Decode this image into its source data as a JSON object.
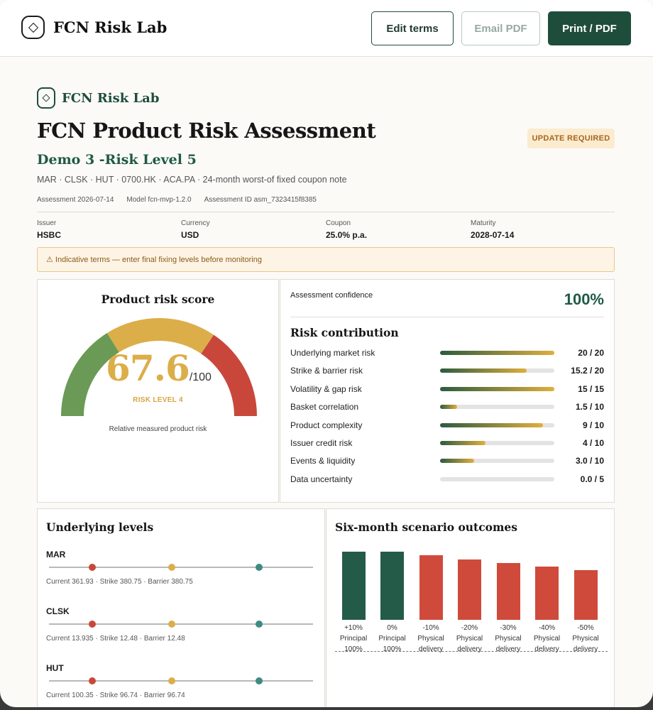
{
  "app": {
    "name": "FCN Risk Lab",
    "buttons": {
      "edit": "Edit terms",
      "email": "Email PDF",
      "print": "Print / PDF"
    }
  },
  "report": {
    "brand": "FCN Risk Lab",
    "title": "FCN Product Risk Assessment",
    "status_badge": "UPDATE REQUIRED",
    "subtitle": "Demo 3 -Risk Level 5",
    "description": "MAR · CLSK · HUT · 0700.HK · ACA.PA · 24-month worst-of fixed coupon note",
    "meta": {
      "assessment": "Assessment 2026-07-14",
      "model": "Model fcn-mvp-1.2.0",
      "assessment_id": "Assessment ID asm_7323415f8385"
    },
    "terms": [
      {
        "label": "Issuer",
        "value": "HSBC"
      },
      {
        "label": "Currency",
        "value": "USD"
      },
      {
        "label": "Coupon",
        "value": "25.0% p.a."
      },
      {
        "label": "Maturity",
        "value": "2028-07-14"
      }
    ],
    "notice": "⚠ Indicative terms — enter final fixing levels before monitoring"
  },
  "score": {
    "title": "Product risk score",
    "value": "67.6",
    "max": "/100",
    "level": "RISK LEVEL 4",
    "caption": "Relative measured product risk",
    "colors": {
      "low": "#6a9a55",
      "mid": "#dcae49",
      "high": "#c9473a"
    }
  },
  "confidence": {
    "label": "Assessment confidence",
    "value": "100%"
  },
  "contribution": {
    "title": "Risk contribution",
    "rows": [
      {
        "label": "Underlying market risk",
        "value": "20 / 20",
        "fraction": 1.0
      },
      {
        "label": "Strike & barrier risk",
        "value": "15.2 / 20",
        "fraction": 0.76
      },
      {
        "label": "Volatility & gap risk",
        "value": "15 / 15",
        "fraction": 1.0
      },
      {
        "label": "Basket correlation",
        "value": "1.5 / 10",
        "fraction": 0.15
      },
      {
        "label": "Product complexity",
        "value": "9 / 10",
        "fraction": 0.9
      },
      {
        "label": "Issuer credit risk",
        "value": "4 / 10",
        "fraction": 0.4
      },
      {
        "label": "Events & liquidity",
        "value": "3.0 / 10",
        "fraction": 0.3
      },
      {
        "label": "Data uncertainty",
        "value": "0.0 / 5",
        "fraction": 0.0
      }
    ]
  },
  "levels": {
    "title": "Underlying levels",
    "items": [
      {
        "ticker": "MAR",
        "info": "Current 361.93 · Strike 380.75 · Barrier 380.75"
      },
      {
        "ticker": "CLSK",
        "info": "Current 13.935 · Strike 12.48 · Barrier 12.48"
      },
      {
        "ticker": "HUT",
        "info": "Current 100.35 · Strike 96.74 · Barrier 96.74"
      }
    ],
    "colors": {
      "red": "#c9473a",
      "yellow": "#dcae49",
      "teal": "#3f8a82"
    }
  },
  "scenarios": {
    "title": "Six-month scenario outcomes",
    "items": [
      {
        "move": "+10%",
        "l1": "Principal",
        "l2": "100%",
        "height": 1.0,
        "color": "#245b48"
      },
      {
        "move": "0%",
        "l1": "Principal",
        "l2": "100%",
        "height": 1.0,
        "color": "#245b48"
      },
      {
        "move": "-10%",
        "l1": "Physical",
        "l2": "delivery",
        "height": 0.95,
        "color": "#cf4a3b"
      },
      {
        "move": "-20%",
        "l1": "Physical",
        "l2": "delivery",
        "height": 0.89,
        "color": "#cf4a3b"
      },
      {
        "move": "-30%",
        "l1": "Physical",
        "l2": "delivery",
        "height": 0.83,
        "color": "#cf4a3b"
      },
      {
        "move": "-40%",
        "l1": "Physical",
        "l2": "delivery",
        "height": 0.78,
        "color": "#cf4a3b"
      },
      {
        "move": "-50%",
        "l1": "Physical",
        "l2": "delivery",
        "height": 0.73,
        "color": "#cf4a3b"
      }
    ]
  }
}
